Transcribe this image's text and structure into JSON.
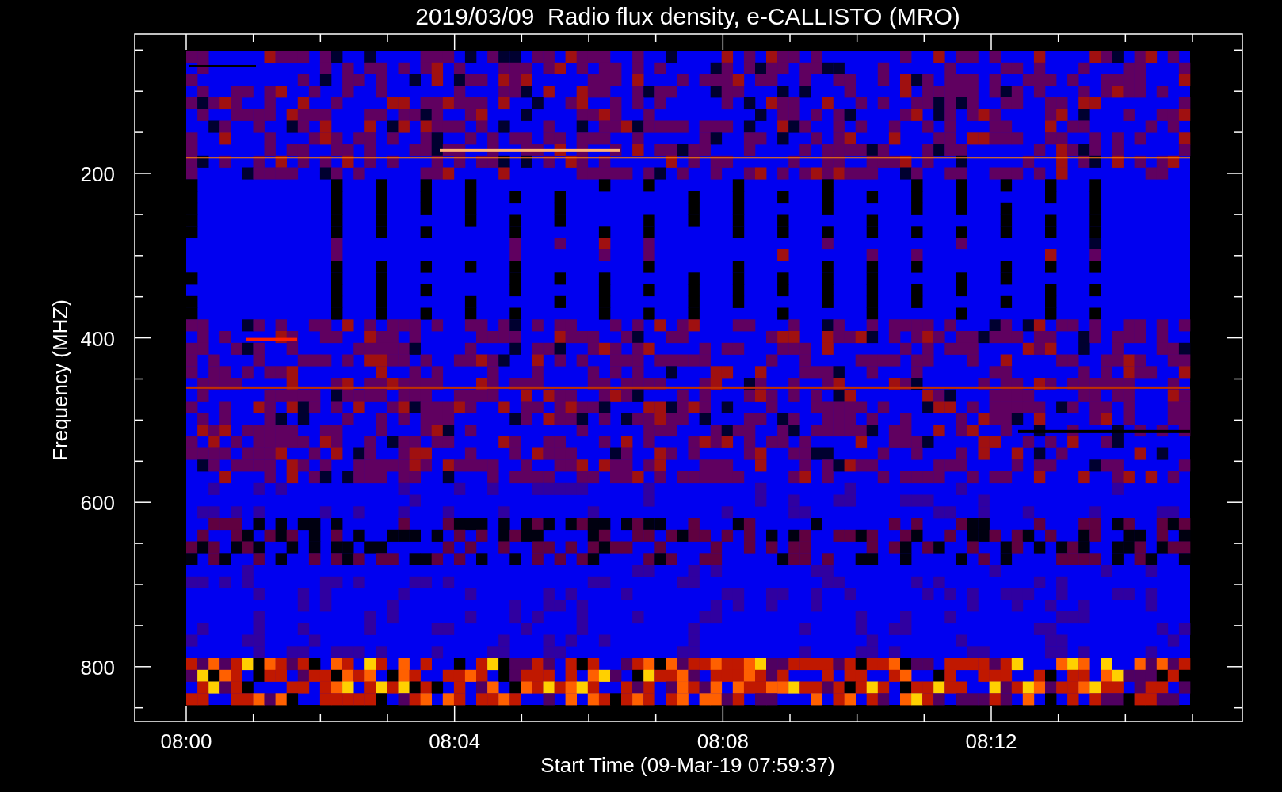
{
  "title": "2019/03/09  Radio flux density, e-CALLISTO (MRO)",
  "y_axis": {
    "label": "Frequency (MHZ)",
    "ticks": [
      "200",
      "400",
      "600",
      "800"
    ]
  },
  "x_axis": {
    "label": "Start Time (09-Mar-19 07:59:37)",
    "ticks": [
      "08:00",
      "08:04",
      "08:08",
      "08:12"
    ]
  }
}
